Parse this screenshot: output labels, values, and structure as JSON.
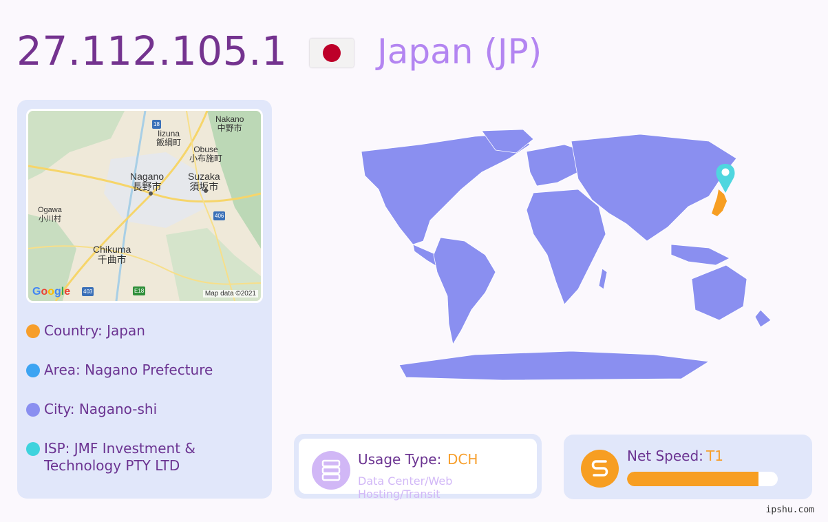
{
  "header": {
    "ip": "27.112.105.1",
    "country_title": "Japan (JP)",
    "flag_icon": "japan-flag-icon"
  },
  "map_thumbnail": {
    "labels": [
      {
        "text": "Nakano\n中野市"
      },
      {
        "text": "Iizuna\n飯綱町"
      },
      {
        "text": "Obuse\n小布施町"
      },
      {
        "text": "Nagano\n長野市"
      },
      {
        "text": "Suzaka\n須坂市"
      },
      {
        "text": "Ogawa\n小川村"
      },
      {
        "text": "Chikuma\n千曲市"
      }
    ],
    "route_badges": [
      "18",
      "406",
      "403",
      "E18"
    ],
    "logo": "Google",
    "attribution": "Map data ©2021"
  },
  "info": {
    "country": "Country: Japan",
    "area": "Area: Nagano Prefecture",
    "city": "City: Nagano-shi",
    "isp": "ISP: JMF Investment & Technology PTY LTD"
  },
  "colors": {
    "country_dot": "#f79e2a",
    "area_dot": "#3ca4f2",
    "city_dot": "#8a8ff0",
    "isp_dot": "#3ed3dd",
    "land": "#8a8ff0",
    "highlight": "#f79e22",
    "pin": "#4fd6df"
  },
  "usage": {
    "label": "Usage Type:",
    "value": "DCH",
    "description": "Data Center/Web Hosting/Transit",
    "icon": "server-icon"
  },
  "speed": {
    "label": "Net Speed:",
    "value": "T1",
    "fill_fraction": 0.87,
    "icon": "speed-icon"
  },
  "footer": {
    "site": "ipshu.com"
  }
}
